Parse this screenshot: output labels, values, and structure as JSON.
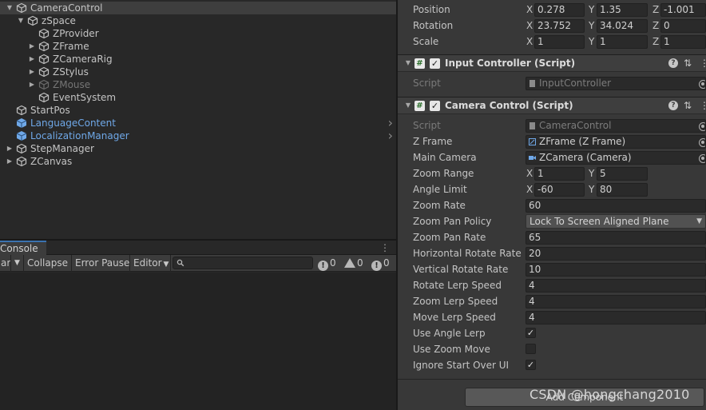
{
  "hierarchy": {
    "items": [
      {
        "label": "CameraControl",
        "fold": "open",
        "style": "normal",
        "selected": true
      },
      {
        "label": "zSpace",
        "fold": "open",
        "style": "normal"
      },
      {
        "label": "ZProvider",
        "fold": "none",
        "style": "normal"
      },
      {
        "label": "ZFrame",
        "fold": "closed",
        "style": "normal"
      },
      {
        "label": "ZCameraRig",
        "fold": "closed",
        "style": "normal"
      },
      {
        "label": "ZStylus",
        "fold": "closed",
        "style": "normal"
      },
      {
        "label": "ZMouse",
        "fold": "closed",
        "style": "dim"
      },
      {
        "label": "EventSystem",
        "fold": "none",
        "style": "normal"
      },
      {
        "label": "StartPos",
        "fold": "none",
        "style": "normal"
      },
      {
        "label": "LanguageContent",
        "fold": "none",
        "style": "prefab"
      },
      {
        "label": "LocalizationManager",
        "fold": "none",
        "style": "prefab"
      },
      {
        "label": "StepManager",
        "fold": "closed",
        "style": "normal"
      },
      {
        "label": "ZCanvas",
        "fold": "closed",
        "style": "normal"
      }
    ]
  },
  "console": {
    "tab_label": "Console",
    "toolbar": {
      "clear_label": "ar",
      "collapse_label": "Collapse",
      "error_pause_label": "Error Pause",
      "editor_label": "Editor",
      "log_count": "0",
      "warning_count": "0",
      "error_count": "0"
    }
  },
  "inspector": {
    "transform": {
      "position": {
        "label": "Position",
        "x": "0.278",
        "y": "1.35",
        "z": "-1.001"
      },
      "rotation": {
        "label": "Rotation",
        "x": "23.752",
        "y": "34.024",
        "z": "0"
      },
      "scale": {
        "label": "Scale",
        "x": "1",
        "y": "1",
        "z": "1"
      }
    },
    "axes": {
      "x": "X",
      "y": "Y",
      "z": "Z"
    },
    "input_controller": {
      "title": "Input Controller (Script)",
      "script_label": "Script",
      "script_value": "InputController"
    },
    "camera_control": {
      "title": "Camera Control (Script)",
      "script_label": "Script",
      "script_value": "CameraControl",
      "z_frame_label": "Z Frame",
      "z_frame_value": "ZFrame (Z Frame)",
      "main_camera_label": "Main Camera",
      "main_camera_value": "ZCamera (Camera)",
      "zoom_range_label": "Zoom Range",
      "zoom_range_x": "1",
      "zoom_range_y": "5",
      "angle_limit_label": "Angle Limit",
      "angle_limit_x": "-60",
      "angle_limit_y": "80",
      "zoom_rate_label": "Zoom Rate",
      "zoom_rate_value": "60",
      "zoom_pan_policy_label": "Zoom Pan Policy",
      "zoom_pan_policy_value": "Lock To Screen Aligned Plane",
      "zoom_pan_rate_label": "Zoom Pan Rate",
      "zoom_pan_rate_value": "65",
      "horizontal_rotate_rate_label": "Horizontal Rotate Rate",
      "horizontal_rotate_rate_value": "20",
      "vertical_rotate_rate_label": "Vertical Rotate Rate",
      "vertical_rotate_rate_value": "10",
      "rotate_lerp_speed_label": "Rotate Lerp Speed",
      "rotate_lerp_speed_value": "4",
      "zoom_lerp_speed_label": "Zoom Lerp Speed",
      "zoom_lerp_speed_value": "4",
      "move_lerp_speed_label": "Move Lerp Speed",
      "move_lerp_speed_value": "4",
      "use_angle_lerp_label": "Use Angle Lerp",
      "use_angle_lerp_checked": true,
      "use_zoom_move_label": "Use Zoom Move",
      "use_zoom_move_checked": false,
      "ignore_start_over_ui_label": "Ignore Start Over UI",
      "ignore_start_over_ui_checked": true
    },
    "add_component_label": "Add Component"
  },
  "watermark": "CSDN @hongchang2010",
  "colors": {
    "prefab_blue": "#6fa8e8",
    "selection": "#3e3e3e",
    "panel_bg": "#282828",
    "inspector_bg": "#383838"
  }
}
